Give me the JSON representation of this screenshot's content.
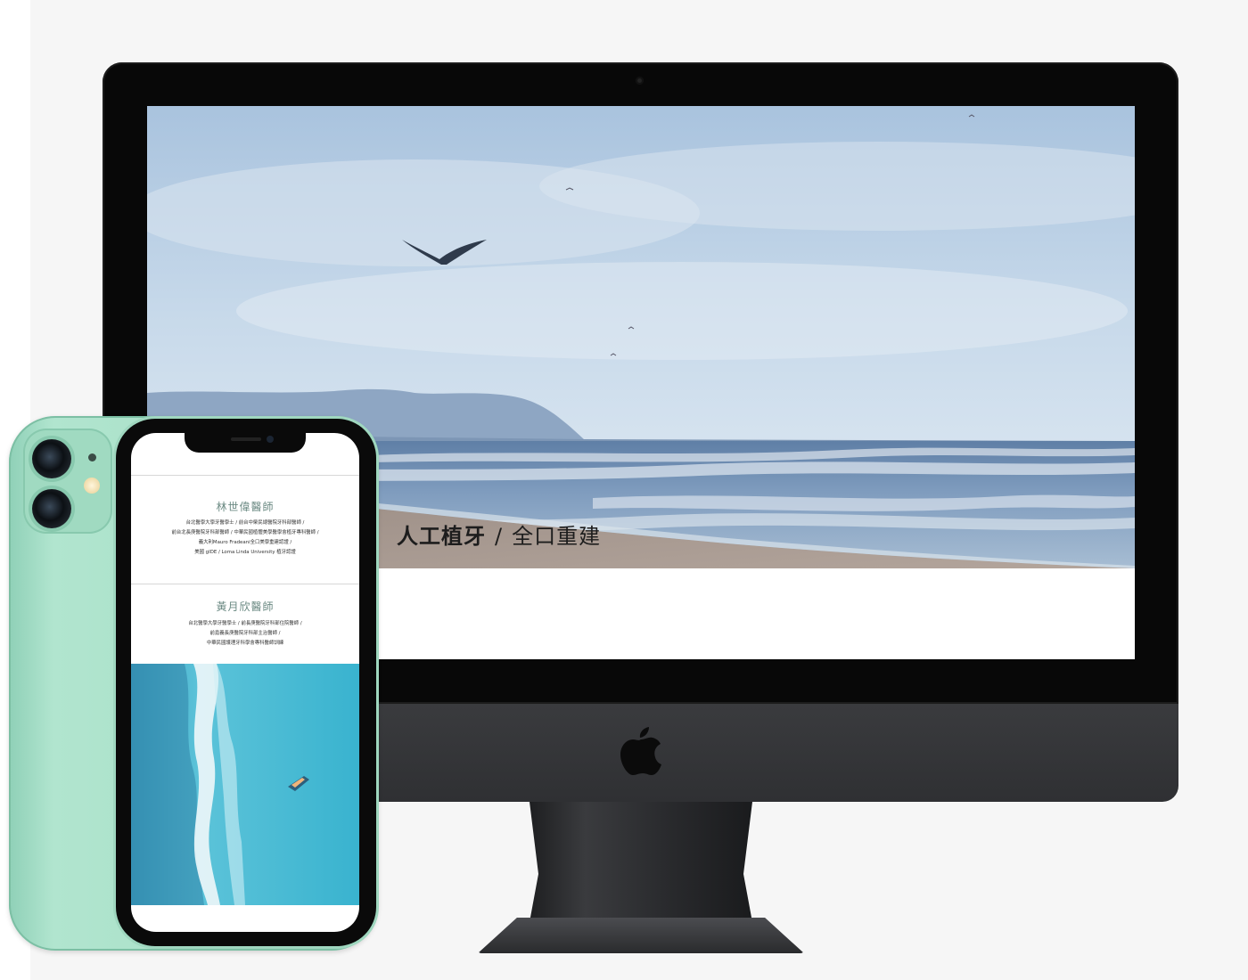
{
  "desktop": {
    "hero_image": "seaside-beach-with-flying-gull",
    "caption_strong": "人工植牙",
    "caption_separator": "/",
    "caption_sub": "全口重建"
  },
  "mobile": {
    "doctors": [
      {
        "name": "林世偉醫師",
        "credentials": [
          "台北醫學大學牙醫學士 / 前台中榮民總醫院牙科部醫師 /",
          "前台北長庚醫院牙科部醫師 / 中華民國植體美學醫學會植牙專科醫師 /",
          "義大利Mauro Fradeani全口美學重建認證 /",
          "美國 gIDE / Loma Linda University 植牙認證"
        ]
      },
      {
        "name": "黃月欣醫師",
        "credentials": [
          "台北醫學大學牙醫學士 / 前長庚醫院牙科部住院醫師 /",
          "前嘉義長庚醫院牙科部主治醫師 /",
          "中華民國護理牙科學會專科醫師訓練"
        ]
      }
    ],
    "bottom_image": "aerial-ocean-waves-with-boat"
  },
  "colors": {
    "phone_body": "#a7dfc6",
    "imac_body": "#2f3033",
    "doctor_name": "#6b8a83"
  }
}
